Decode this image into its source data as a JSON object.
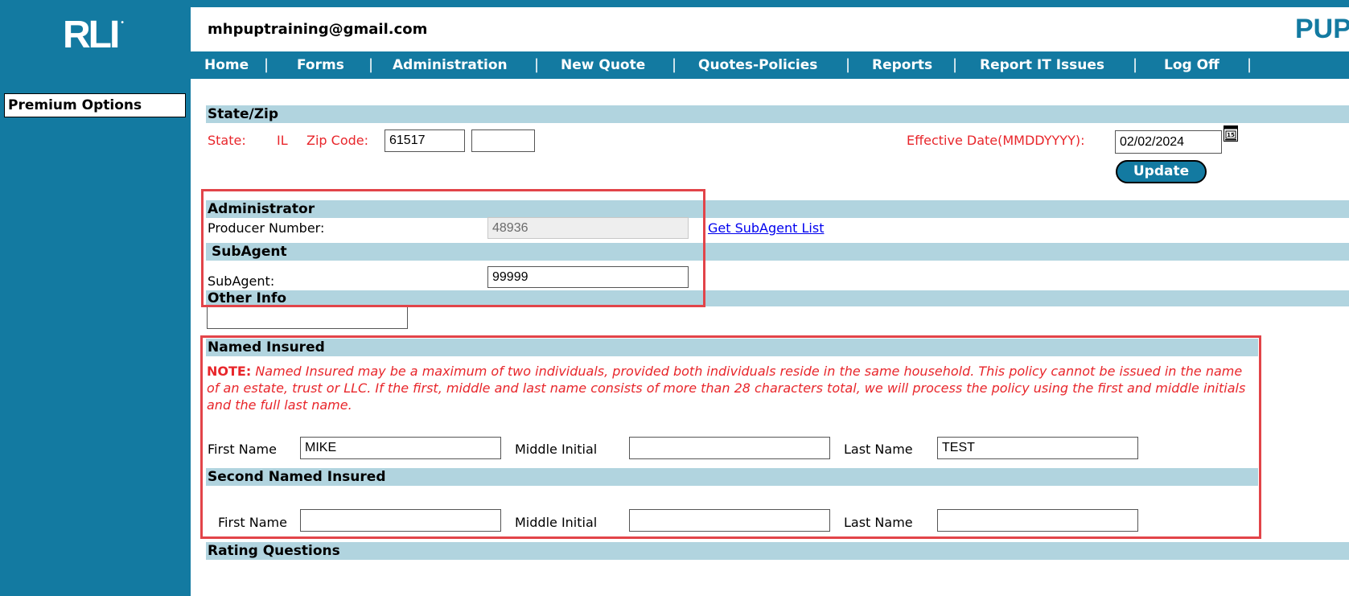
{
  "logo": {
    "text": "RLI",
    "mark": "•"
  },
  "sidebar": {
    "item": "Premium Options"
  },
  "header": {
    "user_email": "mhpuptraining@gmail.com",
    "brand": "PUP"
  },
  "nav": {
    "items": [
      "Home",
      "Forms",
      "Administration",
      "New Quote",
      "Quotes-Policies",
      "Reports",
      "Report IT Issues",
      "Log Off"
    ],
    "separator": "|"
  },
  "state_zip": {
    "section": "State/Zip",
    "state_label": "State:",
    "state_value": "IL",
    "zip_label": "Zip Code:",
    "zip_value": "61517",
    "zip_ext_value": "",
    "effective_label": "Effective Date(MMDDYYYY):",
    "effective_value": "02/02/2024",
    "calendar_icon": "calendar-icon",
    "update_label": "Update"
  },
  "administrator": {
    "section": "Administrator",
    "producer_label": "Producer Number:",
    "producer_value": "48936",
    "link_label": "Get SubAgent List"
  },
  "subagent": {
    "section": "SubAgent",
    "label": "SubAgent:",
    "value": "99999"
  },
  "other_info": {
    "section": "Other Info",
    "value": ""
  },
  "named_insured": {
    "section": "Named Insured",
    "note_prefix": "NOTE:",
    "note_text": "Named Insured may be a maximum of two individuals, provided both individuals reside in the same household. This policy cannot be issued in the name of an estate, trust or LLC. If the first, middle and last name consists of more than 28 characters total, we will process the policy using the first and middle initials and the full last name.",
    "first_label": "First Name",
    "first_value": "MIKE",
    "middle_label": "Middle Initial",
    "middle_value": "",
    "last_label": "Last Name",
    "last_value": "TEST"
  },
  "second_named_insured": {
    "section": "Second Named Insured",
    "first_label": "First Name",
    "first_value": "",
    "middle_label": "Middle Initial",
    "middle_value": "",
    "last_label": "Last Name",
    "last_value": ""
  },
  "rating": {
    "section": "Rating Questions"
  },
  "colors": {
    "brand_blue": "#137aa1",
    "section_bar": "#b1d4df",
    "alert_red": "#e8262b",
    "highlight": "#e24449"
  }
}
